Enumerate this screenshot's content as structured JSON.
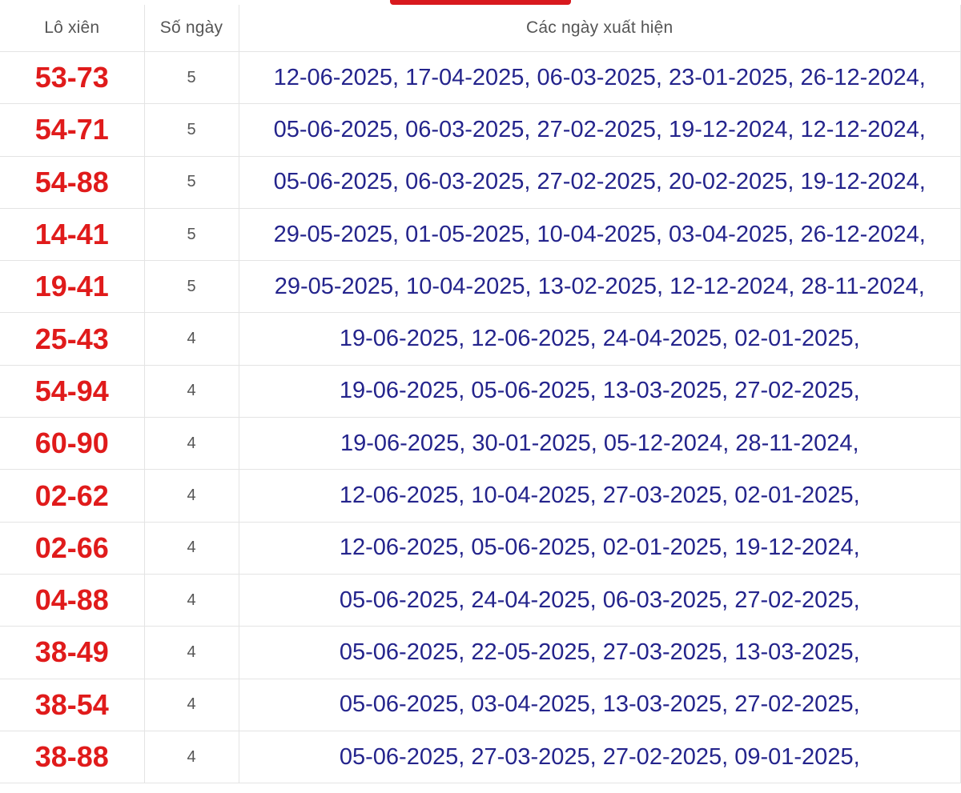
{
  "table": {
    "headers": {
      "pair": "Lô xiên",
      "days": "Số ngày",
      "dates": "Các ngày xuất hiện"
    },
    "rows": [
      {
        "pair": "53-73",
        "days": "5",
        "dates": "12-06-2025, 17-04-2025, 06-03-2025, 23-01-2025, 26-12-2024,"
      },
      {
        "pair": "54-71",
        "days": "5",
        "dates": "05-06-2025, 06-03-2025, 27-02-2025, 19-12-2024, 12-12-2024,"
      },
      {
        "pair": "54-88",
        "days": "5",
        "dates": "05-06-2025, 06-03-2025, 27-02-2025, 20-02-2025, 19-12-2024,"
      },
      {
        "pair": "14-41",
        "days": "5",
        "dates": "29-05-2025, 01-05-2025, 10-04-2025, 03-04-2025, 26-12-2024,"
      },
      {
        "pair": "19-41",
        "days": "5",
        "dates": "29-05-2025, 10-04-2025, 13-02-2025, 12-12-2024, 28-11-2024,"
      },
      {
        "pair": "25-43",
        "days": "4",
        "dates": "19-06-2025, 12-06-2025, 24-04-2025, 02-01-2025,"
      },
      {
        "pair": "54-94",
        "days": "4",
        "dates": "19-06-2025, 05-06-2025, 13-03-2025, 27-02-2025,"
      },
      {
        "pair": "60-90",
        "days": "4",
        "dates": "19-06-2025, 30-01-2025, 05-12-2024, 28-11-2024,"
      },
      {
        "pair": "02-62",
        "days": "4",
        "dates": "12-06-2025, 10-04-2025, 27-03-2025, 02-01-2025,"
      },
      {
        "pair": "02-66",
        "days": "4",
        "dates": "12-06-2025, 05-06-2025, 02-01-2025, 19-12-2024,"
      },
      {
        "pair": "04-88",
        "days": "4",
        "dates": "05-06-2025, 24-04-2025, 06-03-2025, 27-02-2025,"
      },
      {
        "pair": "38-49",
        "days": "4",
        "dates": "05-06-2025, 22-05-2025, 27-03-2025, 13-03-2025,"
      },
      {
        "pair": "38-54",
        "days": "4",
        "dates": "05-06-2025, 03-04-2025, 13-03-2025, 27-02-2025,"
      },
      {
        "pair": "38-88",
        "days": "4",
        "dates": "05-06-2025, 27-03-2025, 27-02-2025, 09-01-2025,"
      }
    ]
  },
  "colors": {
    "accent": "#d8191e",
    "pair_text": "#e01b1b",
    "dates_text": "#24248c",
    "muted_text": "#555555",
    "border": "#e4e4e4"
  }
}
